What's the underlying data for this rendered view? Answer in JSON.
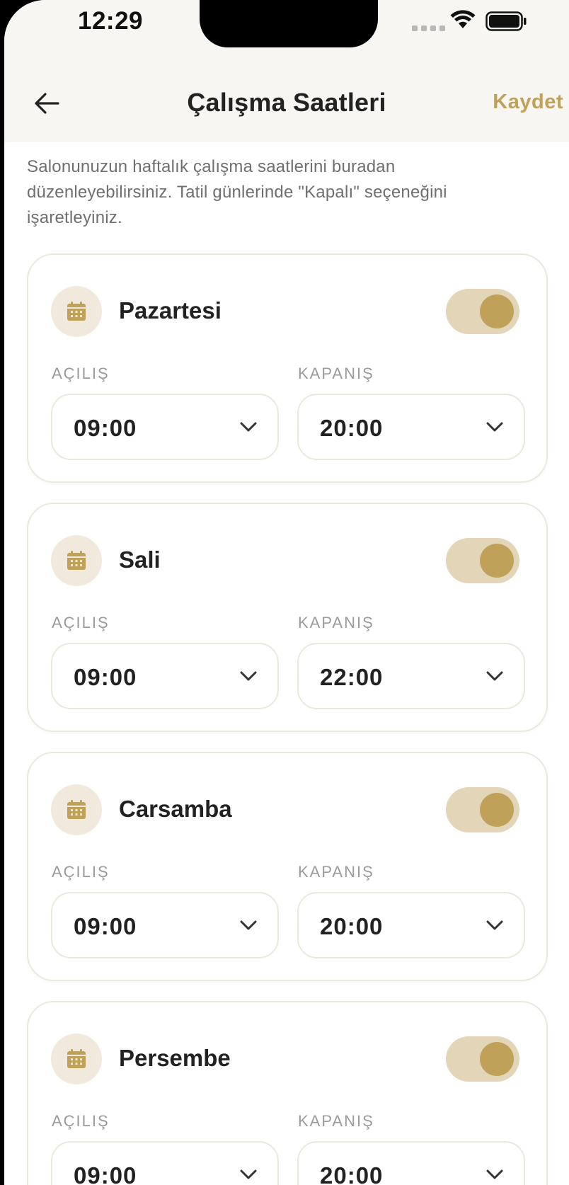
{
  "status": {
    "time": "12:29"
  },
  "header": {
    "title": "Çalışma Saatleri",
    "save_label": "Kaydet"
  },
  "description": "Salonunuzun haftalık çalışma saatlerini buradan düzenleyebilirsiniz. Tatil günlerinde \"Kapalı\" seçeneğini işaretleyiniz.",
  "labels": {
    "open": "AÇILIŞ",
    "close": "KAPANIŞ"
  },
  "days": [
    {
      "name": "Pazartesi",
      "enabled": true,
      "open": "09:00",
      "close": "20:00"
    },
    {
      "name": "Sali",
      "enabled": true,
      "open": "09:00",
      "close": "22:00"
    },
    {
      "name": "Carsamba",
      "enabled": true,
      "open": "09:00",
      "close": "20:00"
    },
    {
      "name": "Persembe",
      "enabled": true,
      "open": "09:00",
      "close": "20:00"
    }
  ],
  "colors": {
    "accent": "#c0a15a",
    "toggle_track": "#e3d6b8",
    "icon_bg": "#f0e9dc"
  },
  "icons": {
    "back": "arrow-left-icon",
    "day": "calendar-icon",
    "dropdown": "chevron-down-icon"
  }
}
